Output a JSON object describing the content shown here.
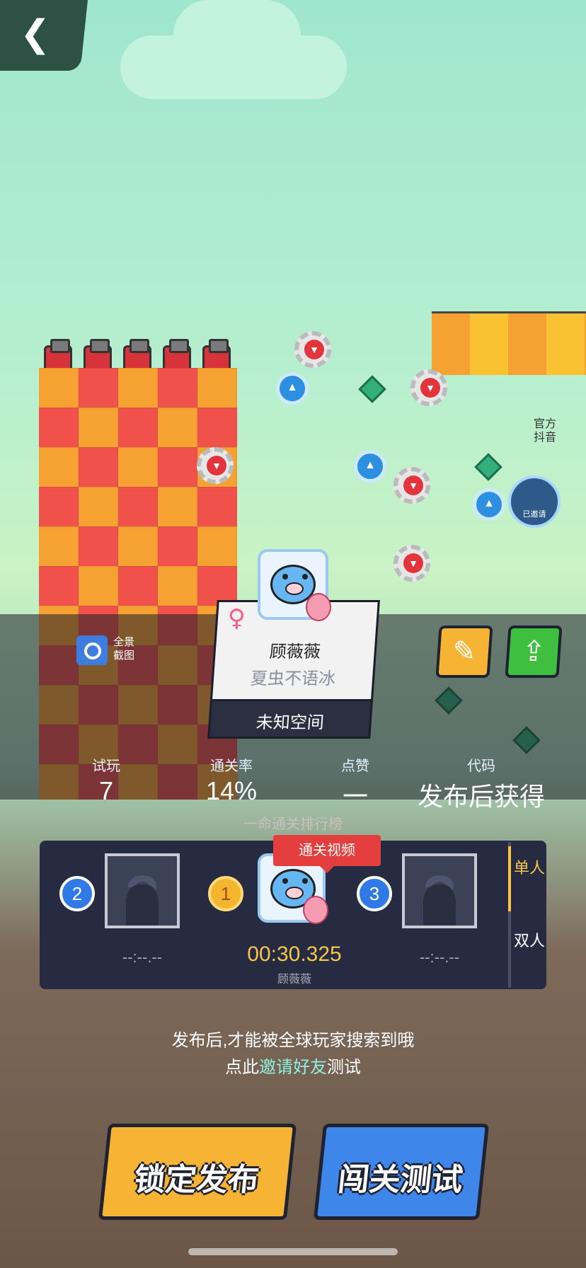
{
  "official": {
    "label_line1": "官方",
    "label_line2": "抖音"
  },
  "invited": {
    "label": "已邀请"
  },
  "screenshot": {
    "label_line1": "全景",
    "label_line2": "截图"
  },
  "card": {
    "author": "顾薇薇",
    "level": "夏虫不语冰",
    "world": "未知空间"
  },
  "stats": [
    {
      "label": "试玩",
      "value": "7"
    },
    {
      "label": "通关率",
      "value": "14%"
    },
    {
      "label": "点赞",
      "value": "一"
    },
    {
      "label": "代码",
      "value": "发布后获得"
    }
  ],
  "leaderboard": {
    "title": "一命通关排行榜",
    "video_tag": "通关视频",
    "tabs": {
      "single": "单人",
      "double": "双人"
    },
    "ranks": [
      {
        "rank": "2",
        "time": "--:--.--"
      },
      {
        "rank": "1",
        "time": "00:30.325",
        "player": "顾薇薇"
      },
      {
        "rank": "3",
        "time": "--:--.--"
      }
    ]
  },
  "hint": {
    "line1": "发布后,才能被全球玩家搜索到哦",
    "line2_prefix": "点此",
    "line2_link": "邀请好友",
    "line2_suffix": "测试"
  },
  "buttons": {
    "publish": "锁定发布",
    "test": "闯关测试"
  },
  "colors": {
    "accent_yellow": "#f6b334",
    "accent_blue": "#3f86ea",
    "panel": "#262b42",
    "link": "#8ef0e0"
  }
}
